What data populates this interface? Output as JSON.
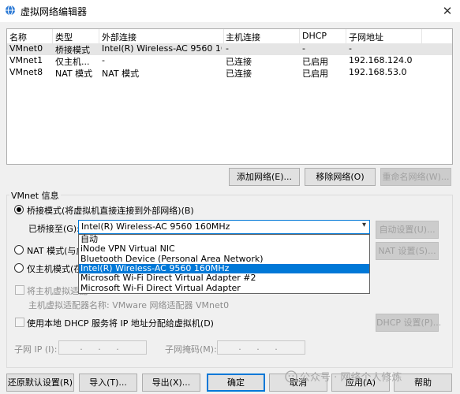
{
  "window": {
    "title": "虚拟网络编辑器",
    "close_glyph": "✕"
  },
  "table": {
    "headers": [
      "名称",
      "类型",
      "外部连接",
      "主机连接",
      "DHCP",
      "子网地址"
    ],
    "rows": [
      [
        "VMnet0",
        "桥接模式",
        "Intel(R) Wireless-AC 9560 16...",
        "-",
        "-",
        "-"
      ],
      [
        "VMnet1",
        "仅主机...",
        "-",
        "已连接",
        "已启用",
        "192.168.124.0"
      ],
      [
        "VMnet8",
        "NAT 模式",
        "NAT 模式",
        "已连接",
        "已启用",
        "192.168.53.0"
      ]
    ]
  },
  "table_buttons": {
    "add": "添加网络(E)...",
    "remove": "移除网络(O)",
    "rename": "重命名网络(W)..."
  },
  "vmnet_info": {
    "group_label": "VMnet 信息",
    "bridged_label": "桥接模式(将虚拟机直接连接到外部网络)(B)",
    "bridged_to_label": "已桥接至(G):",
    "bridged_to_value": "Intel(R) Wireless-AC 9560 160MHz",
    "auto_settings": "自动设置(U)...",
    "nat_label": "NAT 模式(与虚",
    "nat_settings": "NAT 设置(S)...",
    "hostonly_label": "仅主机模式(在",
    "connect_adapter_label": "将主机虚拟适配",
    "adapter_name_label": "主机虚拟适配器名称: VMware 网络适配器 VMnet0",
    "dhcp_label": "使用本地 DHCP 服务将 IP 地址分配给虚拟机(D)",
    "dhcp_settings": "DHCP 设置(P)...",
    "subnet_ip_label": "子网 IP (I):",
    "subnet_ip_value": ". . .",
    "subnet_mask_label": "子网掩码(M):",
    "subnet_mask_value": ". . ."
  },
  "dropdown": {
    "selected_index": 3,
    "options": [
      "自动",
      "iNode VPN Virtual NIC",
      "Bluetooth Device (Personal Area Network)",
      "Intel(R) Wireless-AC 9560 160MHz",
      "Microsoft Wi-Fi Direct Virtual Adapter #2",
      "Microsoft Wi-Fi Direct Virtual Adapter"
    ]
  },
  "footer": {
    "restore": "还原默认设置(R)",
    "import": "导入(T)...",
    "export": "导出(X)...",
    "ok": "确定",
    "cancel": "取消",
    "apply": "应用(A)",
    "help": "帮助"
  },
  "watermark": "公众号 · 网络个人修炼",
  "colors": {
    "accent": "#0078d7",
    "selected_row": "#e5e5e5",
    "disabled_text": "#8d8d8d"
  }
}
